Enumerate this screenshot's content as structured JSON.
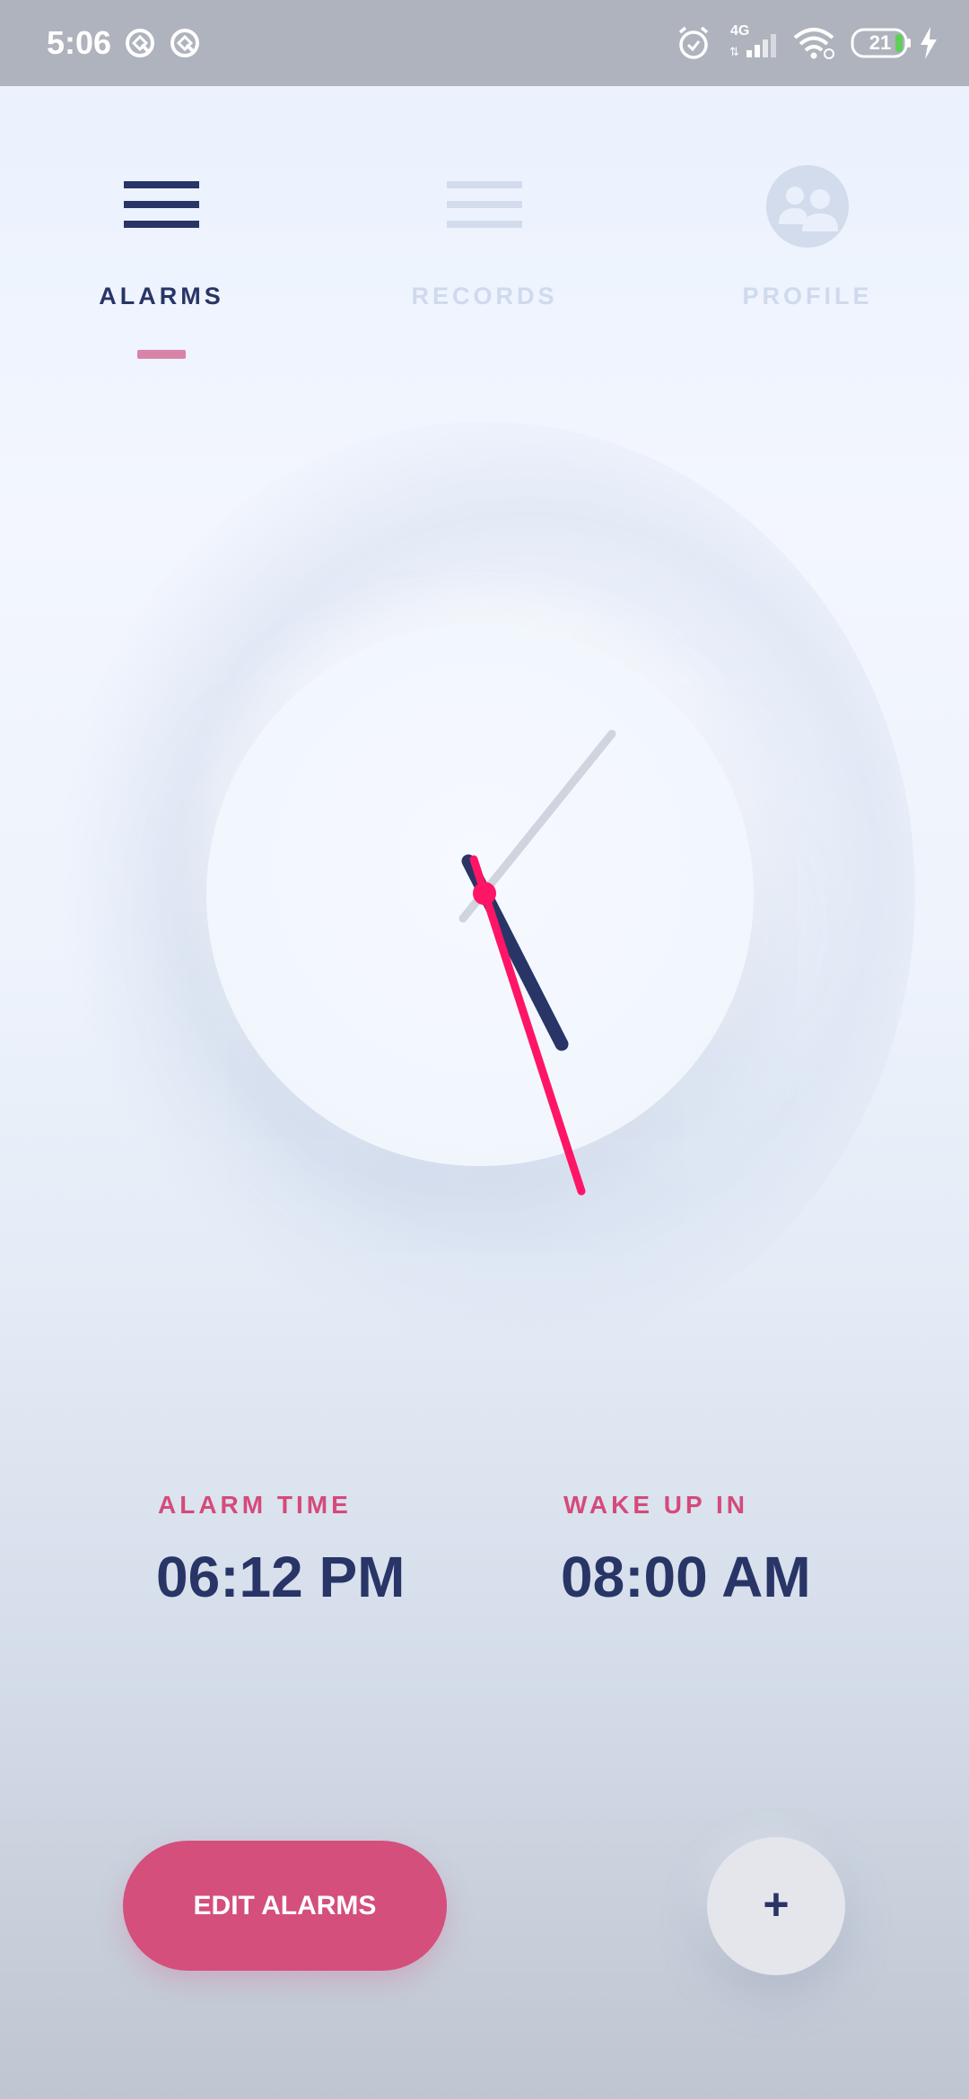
{
  "status_bar": {
    "time": "5:06",
    "network": "4G",
    "battery_level": "21"
  },
  "tabs": [
    {
      "label": "ALARMS",
      "icon": "menu-lines-icon",
      "active": true
    },
    {
      "label": "RECORDS",
      "icon": "list-lines-icon",
      "active": false
    },
    {
      "label": "PROFILE",
      "icon": "people-icon",
      "active": false
    }
  ],
  "clock": {
    "hour_color": "#283566",
    "minute_color": "#ff1566",
    "second_color": "#cfd4de"
  },
  "alarm": {
    "alarm_time_label": "ALARM TIME",
    "alarm_time_value": "06:12 PM",
    "wake_up_label": "WAKE UP IN",
    "wake_up_value": "08:00 AM"
  },
  "actions": {
    "edit_label": "EDIT ALARMS",
    "add_label": "+"
  },
  "colors": {
    "accent": "#d44f7c",
    "navy": "#283566",
    "inactive_tab": "#cfdaec"
  }
}
